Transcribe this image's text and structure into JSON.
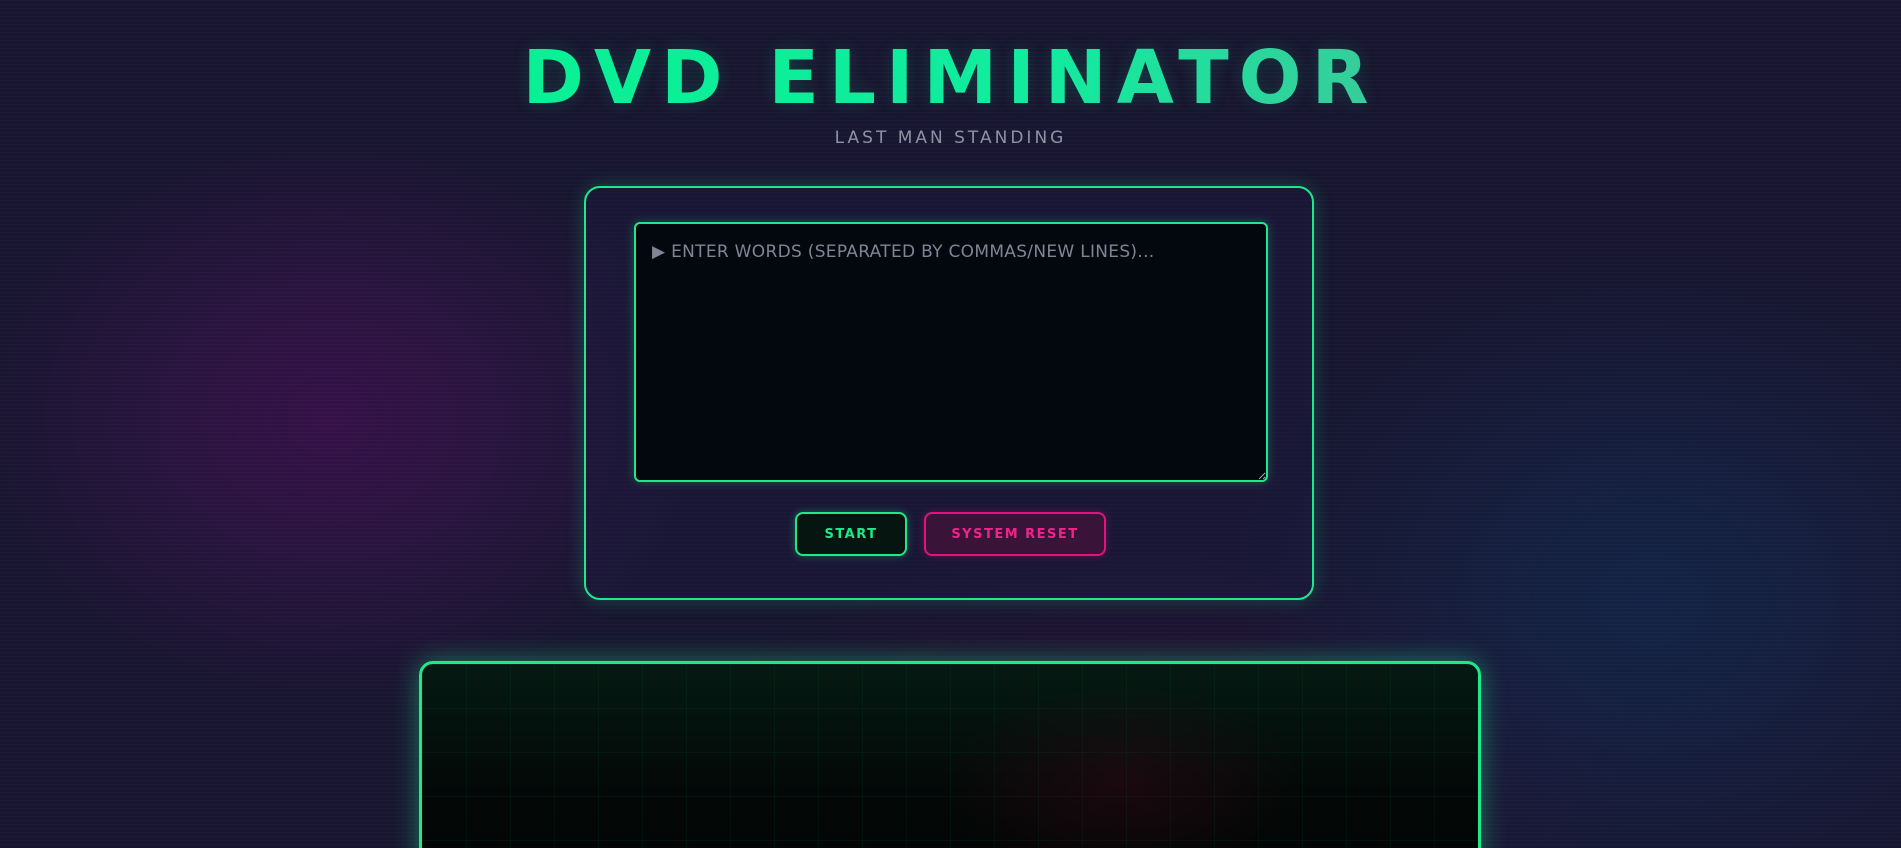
{
  "header": {
    "title": "DVD ELIMINATOR",
    "subtitle": "LAST MAN STANDING"
  },
  "input_panel": {
    "words_input": {
      "value": "",
      "placeholder": "▶ ENTER WORDS (SEPARATED BY COMMAS/NEW LINES)..."
    },
    "start_label": "START",
    "reset_label": "SYSTEM RESET"
  },
  "colors": {
    "accent": "#1ee88a",
    "danger": "#e0147c",
    "background": "#181630"
  }
}
